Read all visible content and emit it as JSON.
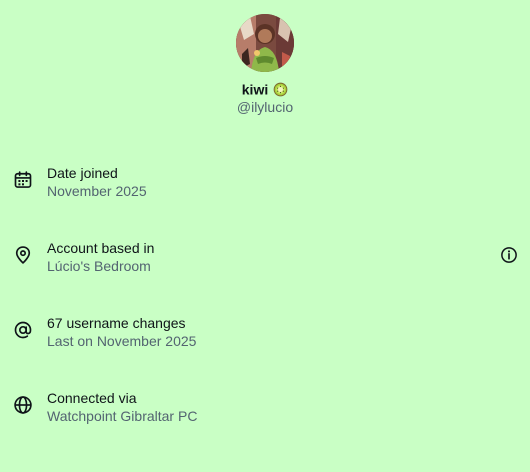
{
  "profile": {
    "display_name": "kiwi",
    "handle": "@ilylucio"
  },
  "details": [
    {
      "icon": "calendar-icon",
      "title": "Date joined",
      "subtitle": "November 2025"
    },
    {
      "icon": "location-pin-icon",
      "title": "Account based in",
      "subtitle": "Lúcio's Bedroom"
    },
    {
      "icon": "at-sign-icon",
      "title": "67 username changes",
      "subtitle": "Last on November 2025"
    },
    {
      "icon": "globe-icon",
      "title": "Connected via",
      "subtitle": "Watchpoint Gibraltar PC"
    }
  ],
  "colors": {
    "background": "#c9ffc5",
    "text_primary": "#0f1419",
    "text_secondary": "#536471"
  }
}
